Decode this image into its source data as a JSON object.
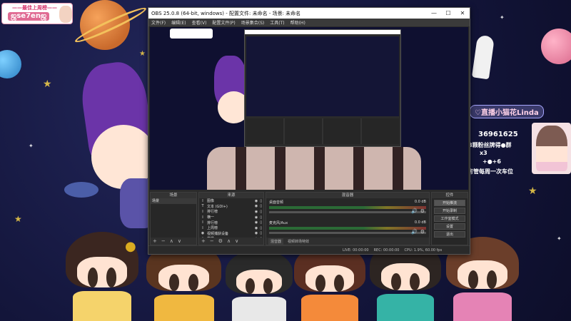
{
  "overlay": {
    "streamer_tag": "ஜse7enஜ",
    "top_ribbon": "——最佳上周榜——",
    "camera_caption": "♡直播小猫花Linda",
    "follower_count": "36961625",
    "follower_label": "8颗粉丝牌得●群",
    "multiplier": "x3",
    "plus_line": "+●+6",
    "bottom_line": "房管每周一次车位"
  },
  "obs": {
    "title": "OBS 25.0.8 (64-bit, windows) - 配置文件: 未命名 - 场景: 未命名",
    "menu": [
      "文件(F)",
      "编辑(E)",
      "查看(V)",
      "配置文件(P)",
      "场景集合(S)",
      "工具(T)",
      "帮助(H)"
    ],
    "docks": {
      "scenes_title": "场景",
      "scenes": [
        "场景"
      ],
      "sources_title": "来源",
      "sources": [
        {
          "icon": "I",
          "name": "图像"
        },
        {
          "icon": "T",
          "name": "文本 (GDI+)"
        },
        {
          "icon": "I",
          "name": "排行榜"
        },
        {
          "icon": "I",
          "name": "横一"
        },
        {
          "icon": "I",
          "name": "排行榜"
        },
        {
          "icon": "I",
          "name": "上周榜"
        },
        {
          "icon": "◉",
          "name": "视频捕获设备"
        },
        {
          "icon": "I",
          "name": "横排"
        }
      ],
      "mixer_title": "混音器",
      "mixer": [
        {
          "name": "桌面音频",
          "db": "0.0 dB"
        },
        {
          "name": "麦克风/Aux",
          "db": "0.0 dB"
        }
      ],
      "mixer_tabs": [
        "混音器",
        "视频转场特效"
      ],
      "controls_title": "控件",
      "controls": [
        "开始推流",
        "开始录制",
        "工作室模式",
        "设置",
        "退出"
      ]
    },
    "status": {
      "live": "LIVE: 00:00:00",
      "rec": "REC: 00:00:00",
      "cpu": "CPU: 1.9%, 60.00 fps"
    }
  }
}
